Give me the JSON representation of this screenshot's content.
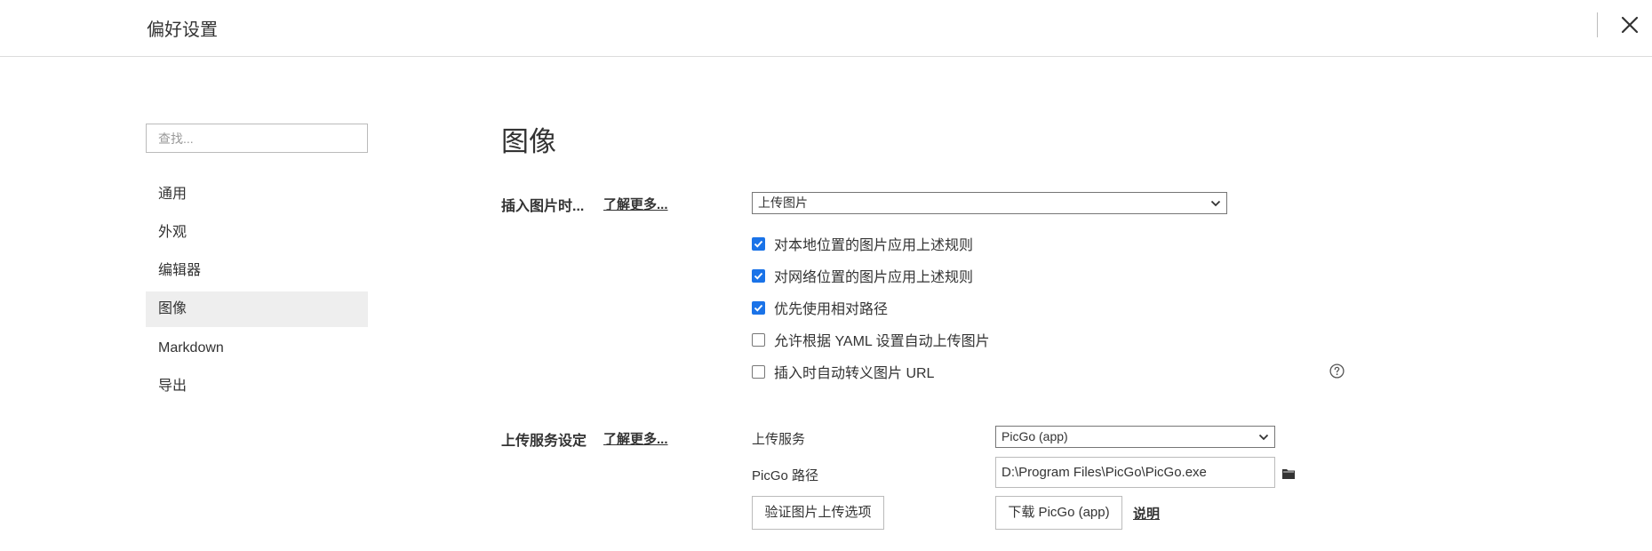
{
  "window": {
    "title": "偏好设置"
  },
  "sidebar": {
    "search_placeholder": "查找...",
    "items": [
      {
        "label": "通用",
        "active": false
      },
      {
        "label": "外观",
        "active": false
      },
      {
        "label": "编辑器",
        "active": false
      },
      {
        "label": "图像",
        "active": true
      },
      {
        "label": "Markdown",
        "active": false
      },
      {
        "label": "导出",
        "active": false
      }
    ]
  },
  "main": {
    "heading": "图像",
    "insert_section": {
      "label": "插入图片时...",
      "learn_more": "了解更多...",
      "action_select": "上传图片",
      "options": [
        {
          "label": "对本地位置的图片应用上述规则",
          "checked": true
        },
        {
          "label": "对网络位置的图片应用上述规则",
          "checked": true
        },
        {
          "label": "优先使用相对路径",
          "checked": true
        },
        {
          "label": "允许根据 YAML 设置自动上传图片",
          "checked": false
        },
        {
          "label": "插入时自动转义图片 URL",
          "checked": false
        }
      ],
      "help_icon": "question-circle-icon"
    },
    "upload_section": {
      "label": "上传服务设定",
      "learn_more": "了解更多...",
      "service_label": "上传服务",
      "service_select": "PicGo (app)",
      "path_label": "PicGo 路径",
      "path_value": "D:\\Program Files\\PicGo\\PicGo.exe",
      "validate_button": "验证图片上传选项",
      "download_button": "下载 PicGo (app)",
      "help_link": "说明"
    }
  },
  "colors": {
    "accent": "#1a73e8",
    "active_bg": "#eeeeee"
  }
}
